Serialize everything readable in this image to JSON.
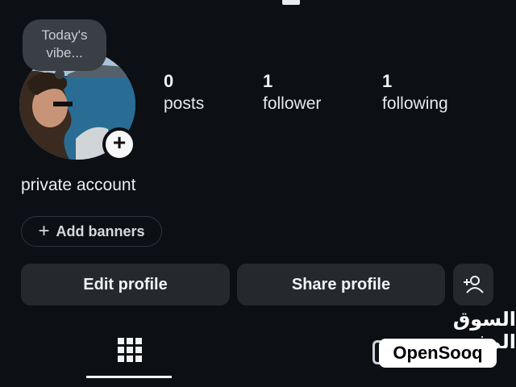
{
  "profile": {
    "note": "Today's vibe...",
    "bio": "private account"
  },
  "stats": {
    "posts": {
      "count": "0",
      "label": "posts"
    },
    "followers": {
      "count": "1",
      "label": "follower"
    },
    "following": {
      "count": "1",
      "label": "following"
    }
  },
  "buttons": {
    "add_banners": "Add banners",
    "edit_profile": "Edit profile",
    "share_profile": "Share profile"
  },
  "icons": {
    "add_story": "plus-icon",
    "add_person": "add-person-icon",
    "grid": "grid-icon",
    "tagged": "tagged-icon"
  },
  "watermark": {
    "arabic": "السوق المفتوح",
    "latin": "OpenSooq"
  },
  "colors": {
    "background": "#0c0f14",
    "button": "#25292e",
    "text": "#f1f3f5"
  }
}
